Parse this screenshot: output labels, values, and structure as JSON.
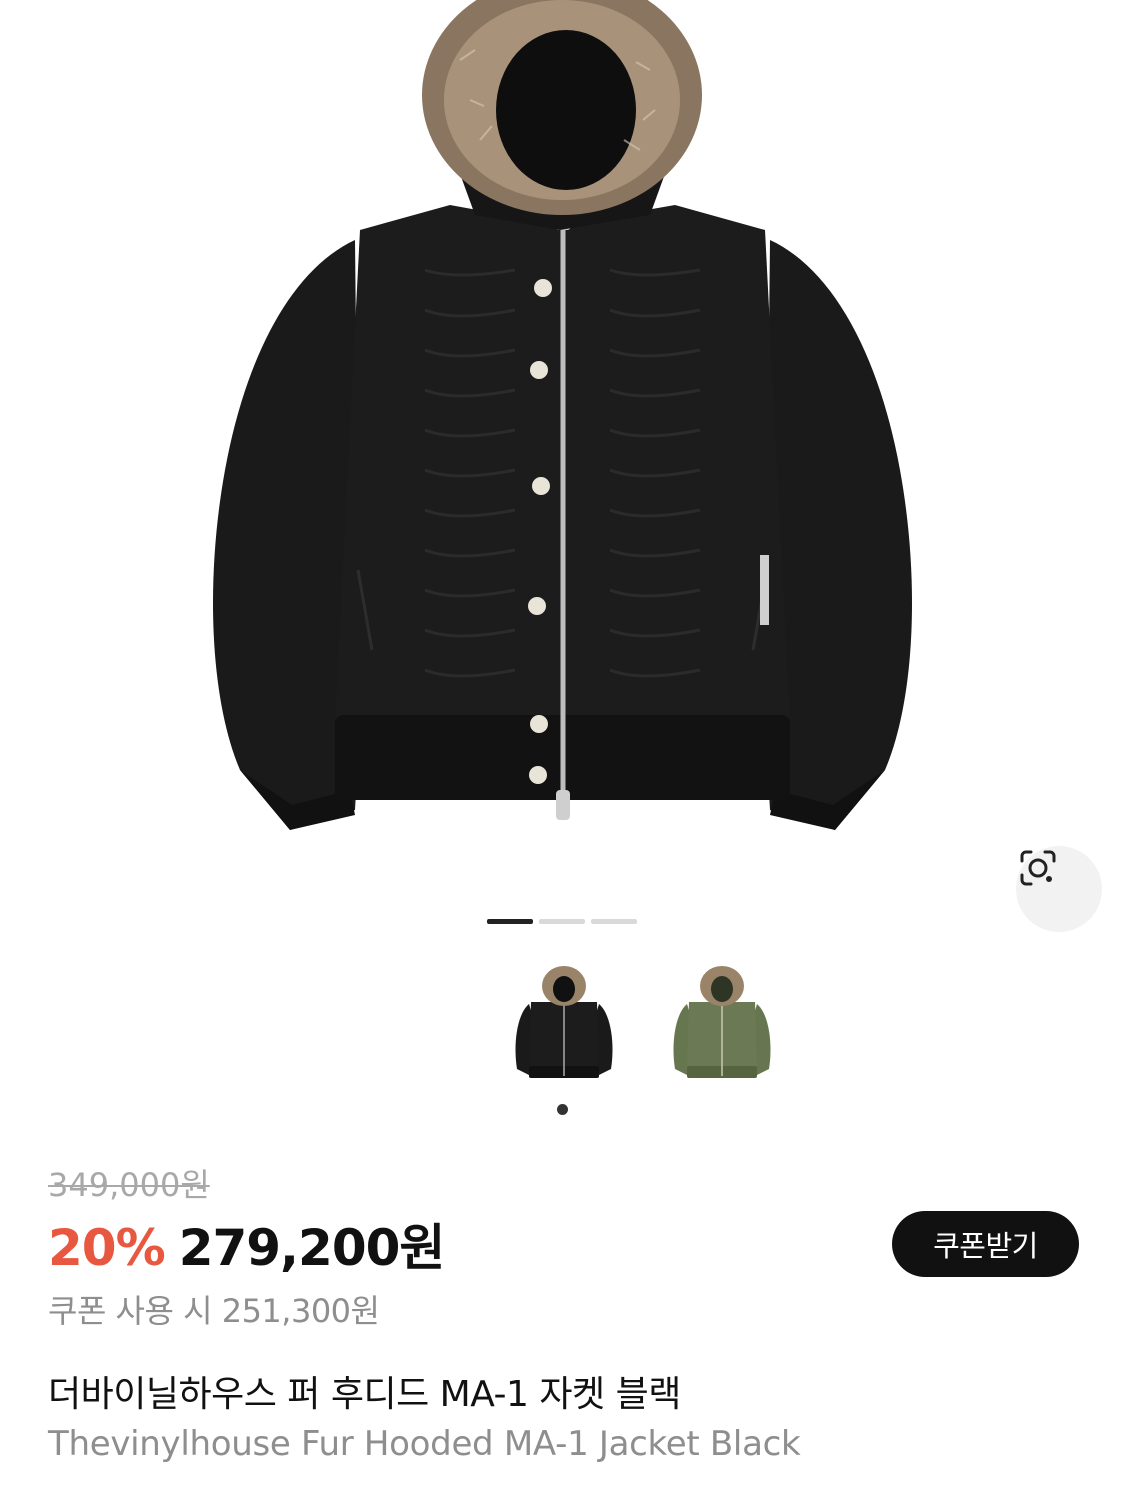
{
  "product": {
    "original_price": "349,000원",
    "discount_rate": "20%",
    "sale_price": "279,200원",
    "coupon_price_text": "쿠폰 사용 시 251,300원",
    "coupon_button_label": "쿠폰받기",
    "title_ko": "더바이닐하우스 퍼 후디드 MA-1 자켓 블랙",
    "title_en": "Thevinylhouse Fur Hooded MA-1 Jacket Black"
  },
  "gallery": {
    "image_count": 3,
    "active_index": 0,
    "color_options": [
      {
        "name": "black",
        "color": "#1b1b1b"
      },
      {
        "name": "olive",
        "color": "#6b7a55"
      }
    ]
  },
  "colors": {
    "discount": "#e85840",
    "button_bg": "#111111",
    "muted_text": "#8e8e8e"
  },
  "icons": {
    "lens": "image-search-icon"
  }
}
